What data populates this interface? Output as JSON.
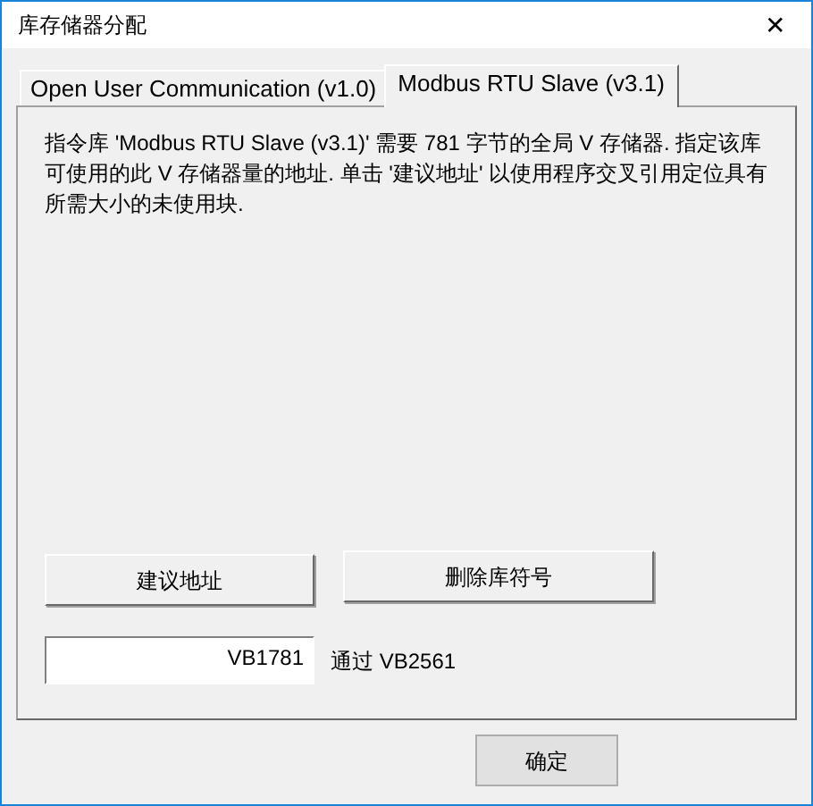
{
  "window": {
    "title": "库存储器分配",
    "close": "✕"
  },
  "tabs": [
    {
      "label": "Open User Communication (v1.0)",
      "selected": false
    },
    {
      "label": "Modbus RTU Slave (v3.1)",
      "selected": true
    }
  ],
  "description": "指令库 'Modbus RTU Slave (v3.1)' 需要 781 字节的全局 V 存储器. 指定该库可使用的此 V 存储器量的地址. 单击 '建议地址' 以使用程序交叉引用定位具有所需大小的未使用块.",
  "buttons": [
    "建议地址",
    "删除库符号"
  ],
  "address_field": {
    "value": "VB1781"
  },
  "range_label": "通过 VB2561",
  "dialog_buttons": [
    "确定"
  ]
}
